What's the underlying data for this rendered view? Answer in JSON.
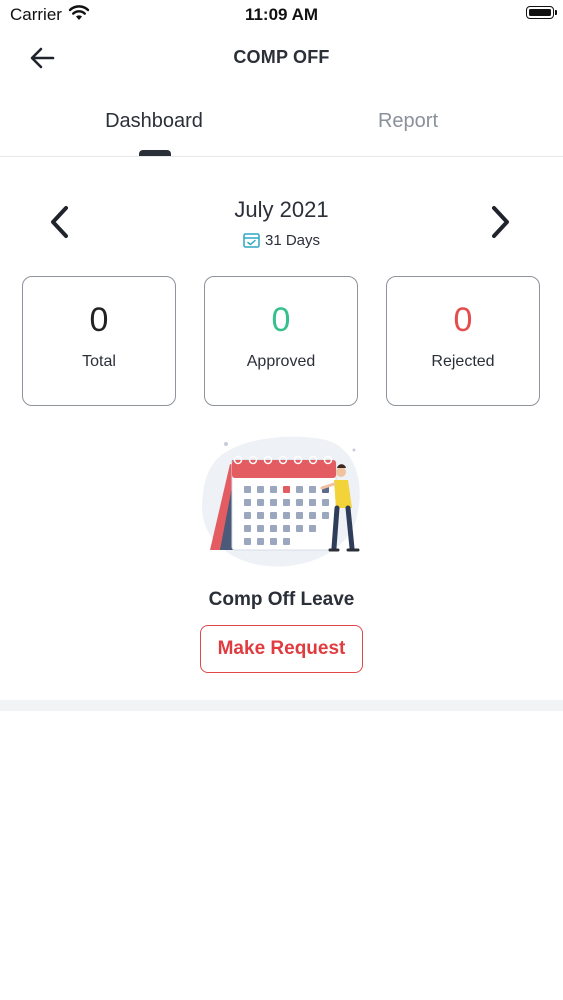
{
  "status_bar": {
    "carrier": "Carrier",
    "time": "11:09 AM"
  },
  "header": {
    "title": "COMP OFF",
    "back_icon": "arrow-left-icon"
  },
  "tabs": [
    {
      "label": "Dashboard",
      "active": true
    },
    {
      "label": "Report",
      "active": false
    }
  ],
  "period": {
    "month": "July 2021",
    "days": "31 Days",
    "prev_icon": "chevron-left-icon",
    "next_icon": "chevron-right-icon"
  },
  "stats": [
    {
      "value": "0",
      "label": "Total",
      "color": "#222222"
    },
    {
      "value": "0",
      "label": "Approved",
      "color": "#36c08c"
    },
    {
      "value": "0",
      "label": "Rejected",
      "color": "#e54d4d"
    }
  ],
  "empty_state": {
    "title": "Comp Off Leave",
    "button_label": "Make Request",
    "accent": "#e03c3f"
  }
}
